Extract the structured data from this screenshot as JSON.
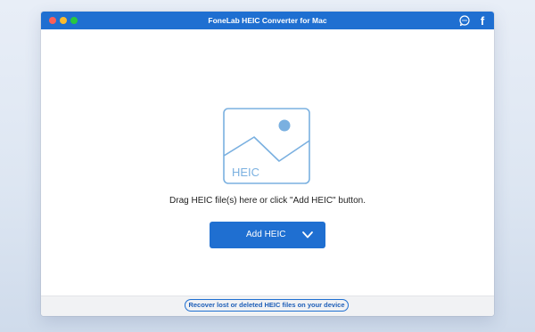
{
  "window": {
    "title": "FoneLab HEIC Converter for Mac"
  },
  "titlebar": {
    "icons": [
      "chat-icon",
      "facebook-icon"
    ],
    "facebook_glyph": "f"
  },
  "dropzone": {
    "graphic_label": "HEIC",
    "instruction": "Drag HEIC file(s) here or click \"Add HEIC\" button."
  },
  "actions": {
    "add_label": "Add HEIC"
  },
  "footer": {
    "recover_link": "Recover lost or deleted HEIC files on your device"
  },
  "colors": {
    "accent": "#1f6fd1",
    "graphic": "#7ab0e0"
  }
}
